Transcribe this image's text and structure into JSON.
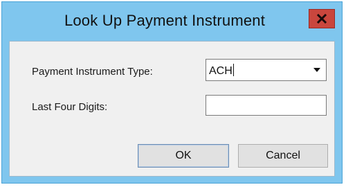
{
  "dialog": {
    "title": "Look Up Payment Instrument",
    "close_icon": "close-icon",
    "accent_color": "#7fc6ee",
    "close_color": "#c9463d"
  },
  "form": {
    "payment_type_label": "Payment Instrument Type:",
    "payment_type_value": "ACH",
    "last_four_label": "Last Four Digits:",
    "last_four_value": "",
    "last_four_placeholder": ""
  },
  "buttons": {
    "ok_label": "OK",
    "cancel_label": "Cancel"
  }
}
